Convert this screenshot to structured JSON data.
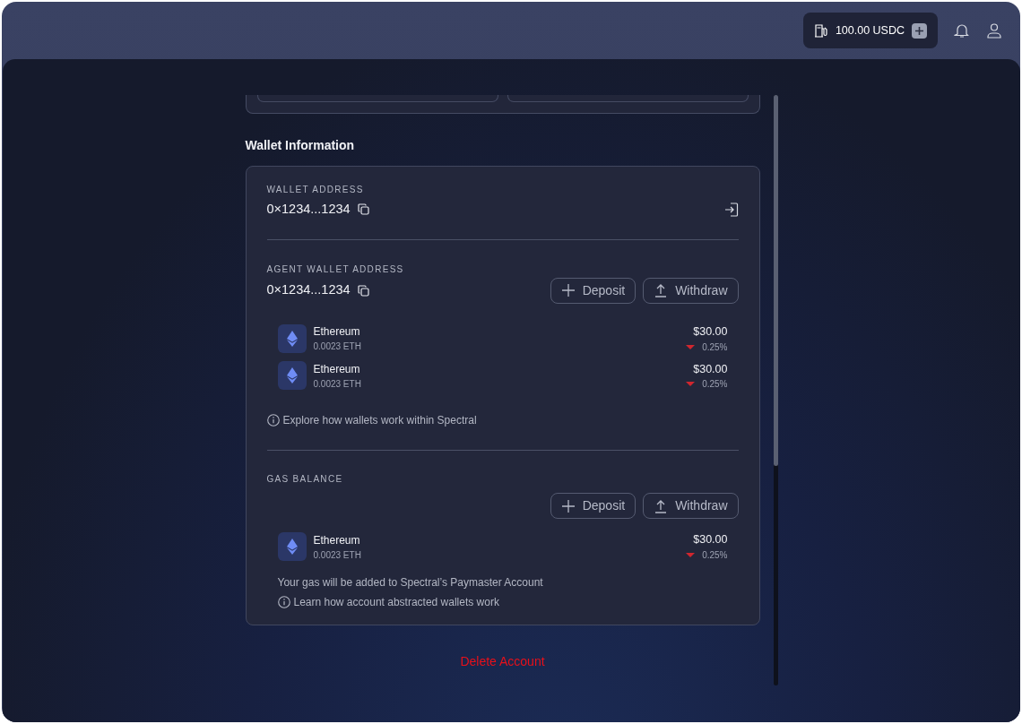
{
  "top_bar": {
    "gas_balance": "100.00 USDC"
  },
  "section_title": "Wallet Information",
  "wallet": {
    "label": "WALLET ADDRESS",
    "address": "0×1234...1234"
  },
  "agent_wallet": {
    "label": "AGENT WALLET ADDRESS",
    "address": "0×1234...1234",
    "buttons": [
      {
        "kind": "deposit",
        "label": "Deposit"
      },
      {
        "kind": "withdraw",
        "label": "Withdraw"
      }
    ],
    "assets": [
      {
        "name": "Ethereum",
        "amount": "0.0023 ETH",
        "value": "$30.00",
        "change": "0.25%",
        "falling": true
      },
      {
        "name": "Ethereum",
        "amount": "0.0023 ETH",
        "value": "$30.00",
        "change": "0.25%",
        "falling": true
      }
    ],
    "info_link": "Explore how wallets work within Spectral"
  },
  "gas_balance": {
    "label": "GAS BALANCE",
    "buttons": [
      {
        "kind": "deposit",
        "label": "Deposit"
      },
      {
        "kind": "withdraw",
        "label": "Withdraw"
      }
    ],
    "assets": [
      {
        "name": "Ethereum",
        "amount": "0.0023 ETH",
        "value": "$30.00",
        "change": "0.25%",
        "falling": true
      }
    ],
    "note": "Your gas will be added to Spectral’s Paymaster Account",
    "info_link": "Learn how account abstracted wallets work"
  },
  "delete_button": "Delete Account"
}
